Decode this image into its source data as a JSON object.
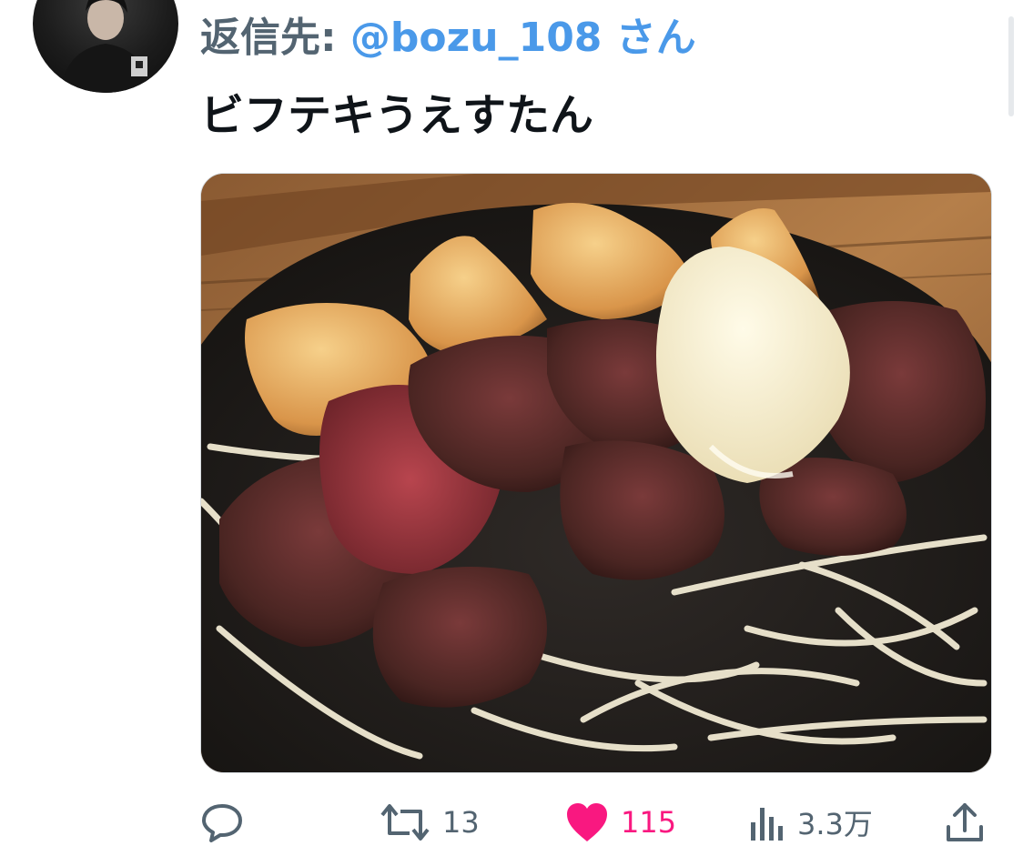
{
  "reply": {
    "prefix": "返信先: ",
    "handle": "@bozu_108",
    "suffix": " さん"
  },
  "tweet": {
    "text": "ビフテキうえすたん"
  },
  "actions": {
    "reply_icon": "comment-bubble-icon",
    "retweet_icon": "retweet-icon",
    "retweet_count": "13",
    "like_icon": "heart-icon",
    "like_count": "115",
    "views_icon": "bar-chart-icon",
    "views_count": "3.3万",
    "share_icon": "share-upload-icon"
  },
  "colors": {
    "handle": "#4a99e9",
    "like": "#f91880",
    "muted": "#536471",
    "text": "#0f1419"
  }
}
